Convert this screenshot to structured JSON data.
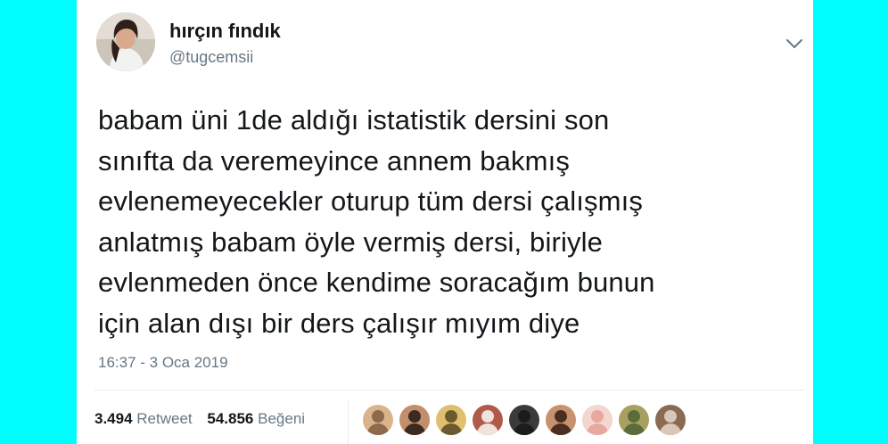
{
  "tweet": {
    "display_name": "hırçın fındık",
    "handle": "@tugcemsii",
    "text": "babam üni 1de aldığı istatistik dersini son\nsınıfta da veremeyince annem bakmış\nevlenemeyecekler oturup tüm dersi çalışmış\nanlatmış babam öyle vermiş dersi, biriyle\nevlenmeden önce kendime soracağım bunun\niçin alan dışı bir ders çalışır mıyım diye",
    "timestamp": "16:37 - 3 Oca 2019",
    "menu_icon": "chevron-down-icon"
  },
  "stats": {
    "retweet_count": "3.494",
    "retweet_label": "Retweet",
    "like_count": "54.856",
    "like_label": "Beğeni"
  },
  "likers": [
    {
      "icon": "avatar",
      "colors": [
        "#8c6a4a",
        "#d9b38c"
      ]
    },
    {
      "icon": "avatar",
      "colors": [
        "#3b2a20",
        "#c28e6b"
      ]
    },
    {
      "icon": "avatar",
      "colors": [
        "#6b5a2e",
        "#e0c070"
      ]
    },
    {
      "icon": "avatar",
      "colors": [
        "#efe3dc",
        "#b05a4a"
      ]
    },
    {
      "icon": "avatar",
      "colors": [
        "#1c1c1c",
        "#3a3a3a"
      ]
    },
    {
      "icon": "avatar",
      "colors": [
        "#4a2e22",
        "#c9926e"
      ]
    },
    {
      "icon": "avatar",
      "colors": [
        "#e8a8a0",
        "#f3d6cf"
      ]
    },
    {
      "icon": "avatar",
      "colors": [
        "#5c6b3a",
        "#a8a060"
      ]
    },
    {
      "icon": "avatar",
      "colors": [
        "#d8c8b8",
        "#8a6a52"
      ]
    }
  ],
  "colors": {
    "background": "#00fdfd",
    "card": "#ffffff",
    "primary_text": "#14171a",
    "secondary_text": "#657786"
  }
}
